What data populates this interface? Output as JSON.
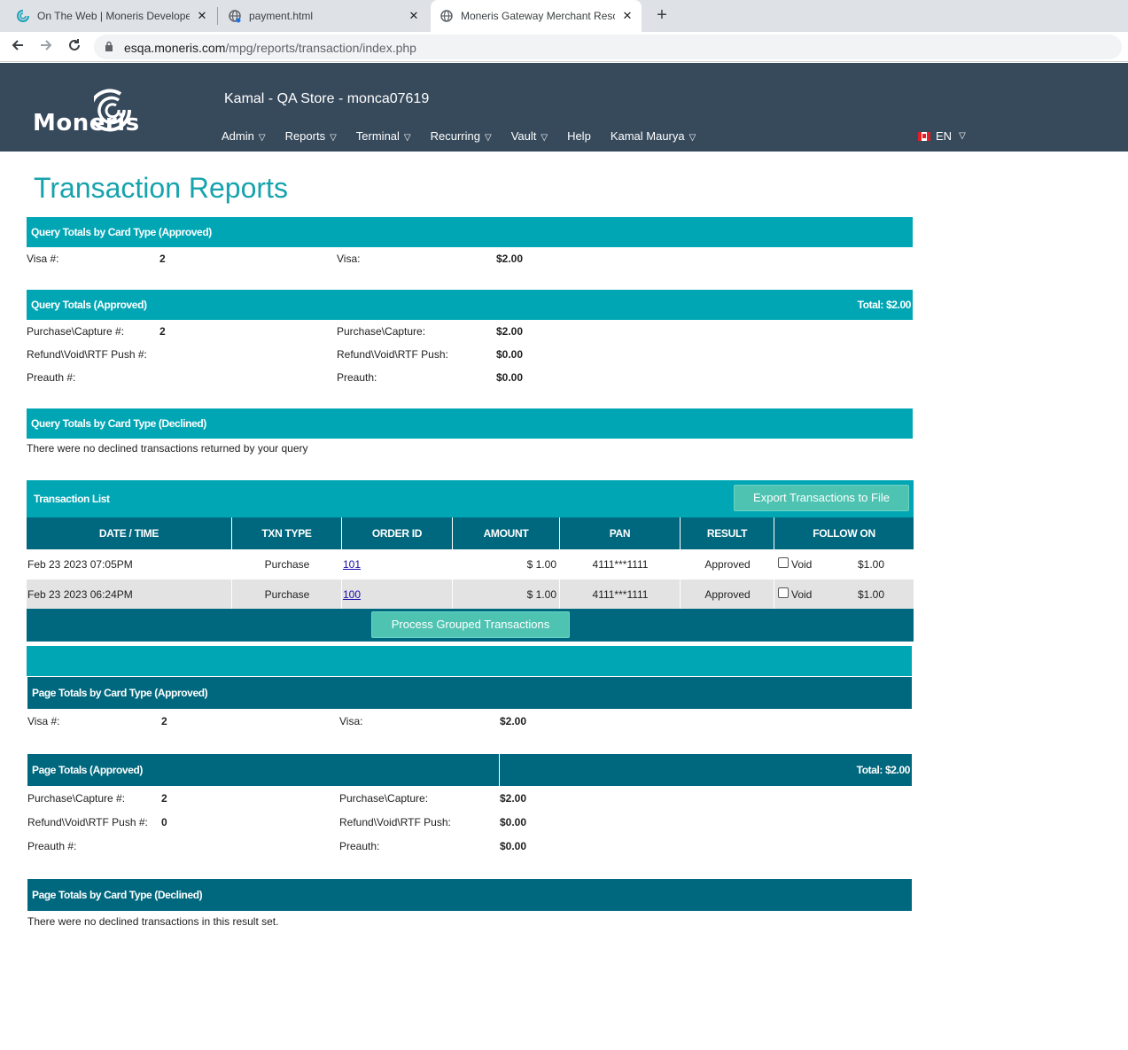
{
  "browser": {
    "tabs": [
      {
        "title": "On The Web | Moneris Developer",
        "icon": "moneris-swirl-icon",
        "active": false
      },
      {
        "title": "payment.html",
        "icon": "globe-icon",
        "active": false
      },
      {
        "title": "Moneris Gateway Merchant Reso",
        "icon": "globe-icon",
        "active": true
      }
    ],
    "url_host": "esqa.moneris.com",
    "url_path": "/mpg/reports/transaction/index.php"
  },
  "header": {
    "logo_text": "Moneris",
    "store_title": "Kamal - QA Store - monca07619",
    "nav": [
      "Admin",
      "Reports",
      "Terminal",
      "Recurring",
      "Vault",
      "Help",
      "Kamal Maurya"
    ],
    "nav_has_dropdown": [
      true,
      true,
      true,
      true,
      true,
      false,
      true
    ],
    "lang": "EN",
    "colors": {
      "header_bg": "#374a5c",
      "accent": "#00a6b4",
      "dark_accent": "#00687e",
      "title": "#16a3ad",
      "button": "#4fc3b2"
    }
  },
  "page_title": "Transaction Reports",
  "query_card_approved": {
    "title": "Query Totals by Card Type (Approved)",
    "count_label": "Visa #:",
    "count_value": "2",
    "amount_label": "Visa:",
    "amount_value": "$2.00"
  },
  "query_totals_approved": {
    "title": "Query Totals (Approved)",
    "total": "Total: $2.00",
    "rows": [
      {
        "count_label": "Purchase\\Capture #:",
        "count_value": "2",
        "amount_label": "Purchase\\Capture:",
        "amount_value": "$2.00"
      },
      {
        "count_label": "Refund\\Void\\RTF Push #:",
        "count_value": "",
        "amount_label": "Refund\\Void\\RTF Push:",
        "amount_value": "$0.00"
      },
      {
        "count_label": "Preauth #:",
        "count_value": "",
        "amount_label": "Preauth:",
        "amount_value": "$0.00"
      }
    ]
  },
  "query_card_declined": {
    "title": "Query Totals by Card Type (Declined)",
    "message": "There were no declined transactions returned by your query"
  },
  "transaction_list": {
    "title": "Transaction List",
    "export_button": "Export Transactions to File",
    "columns": [
      "DATE / TIME",
      "TXN TYPE",
      "ORDER ID",
      "AMOUNT",
      "PAN",
      "RESULT",
      "FOLLOW ON"
    ],
    "rows": [
      {
        "datetime": "Feb 23 2023 07:05PM",
        "type": "Purchase",
        "order_id": "101",
        "amount": "$ 1.00",
        "pan": "4111***1111",
        "result": "Approved",
        "follow_label": "Void",
        "follow_amount": "$1.00"
      },
      {
        "datetime": "Feb 23 2023 06:24PM",
        "type": "Purchase",
        "order_id": "100",
        "amount": "$ 1.00",
        "pan": "4111***1111",
        "result": "Approved",
        "follow_label": "Void",
        "follow_amount": "$1.00"
      }
    ],
    "process_button": "Process Grouped Transactions"
  },
  "page_card_approved": {
    "title": "Page Totals by Card Type (Approved)",
    "count_label": "Visa #:",
    "count_value": "2",
    "amount_label": "Visa:",
    "amount_value": "$2.00"
  },
  "page_totals_approved": {
    "title": "Page Totals (Approved)",
    "total": "Total: $2.00",
    "rows": [
      {
        "count_label": "Purchase\\Capture #:",
        "count_value": "2",
        "amount_label": "Purchase\\Capture:",
        "amount_value": "$2.00"
      },
      {
        "count_label": "Refund\\Void\\RTF Push #:",
        "count_value": "0",
        "amount_label": "Refund\\Void\\RTF Push:",
        "amount_value": "$0.00"
      },
      {
        "count_label": "Preauth #:",
        "count_value": "",
        "amount_label": "Preauth:",
        "amount_value": "$0.00"
      }
    ]
  },
  "page_card_declined": {
    "title": "Page Totals by Card Type (Declined)",
    "message": "There were no declined transactions in this result set."
  }
}
